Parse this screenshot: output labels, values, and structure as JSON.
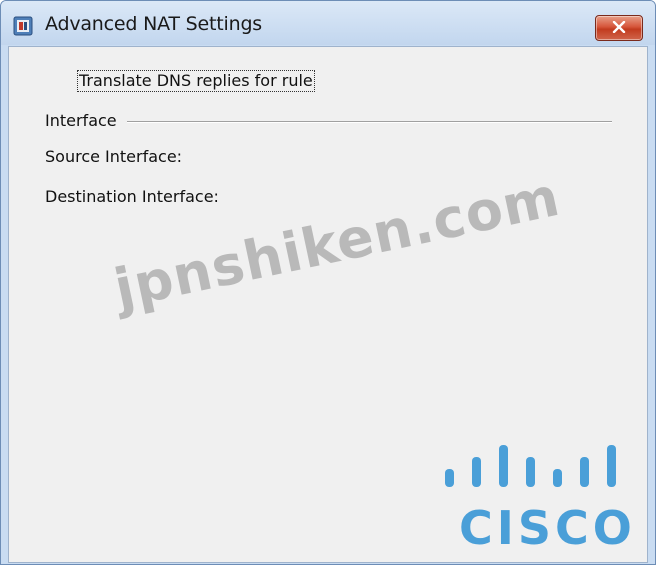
{
  "window": {
    "title": "Advanced NAT Settings",
    "close_icon": "close-icon",
    "app_icon": "asdm-app-icon"
  },
  "options": {
    "translate_dns_label": "Translate DNS replies for rule"
  },
  "interface_group": {
    "header": "Interface",
    "source_label": "Source Interface:",
    "destination_label": "Destination Interface:"
  },
  "watermark": {
    "text": "jpnshiken.com"
  },
  "logo": {
    "text": "CISCO",
    "color": "#4a9fd8"
  },
  "colors": {
    "titlebar": "#c9dcf2",
    "client_bg": "#f0f0f0",
    "close_button": "#c94a2e"
  }
}
